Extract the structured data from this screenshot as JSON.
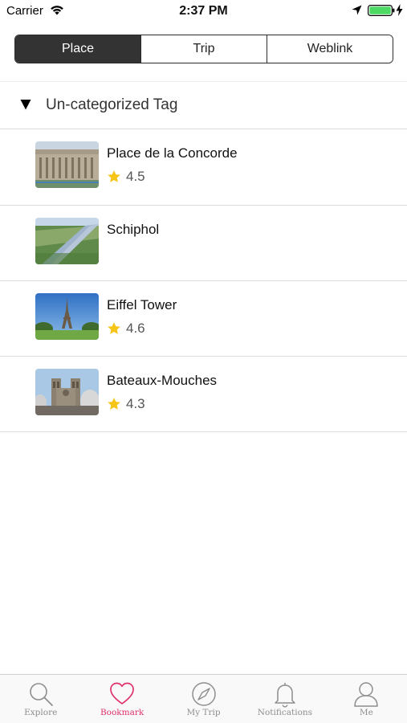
{
  "status_bar": {
    "carrier": "Carrier",
    "time": "2:37 PM",
    "battery_color": "#4cd964"
  },
  "segments": [
    {
      "label": "Place",
      "active": true
    },
    {
      "label": "Trip",
      "active": false
    },
    {
      "label": "Weblink",
      "active": false
    }
  ],
  "section": {
    "title": "Un-categorized Tag",
    "icon": "triangle-down-icon"
  },
  "places": [
    {
      "name": "Place de la Concorde",
      "rating": "4.5",
      "thumb": "building-photo"
    },
    {
      "name": "Schiphol",
      "rating": "",
      "thumb": "river-aerial-photo"
    },
    {
      "name": "Eiffel Tower",
      "rating": "4.6",
      "thumb": "eiffel-tower-photo"
    },
    {
      "name": "Bateaux-Mouches",
      "rating": "4.3",
      "thumb": "cathedral-photo"
    }
  ],
  "tab_bar": {
    "accent_color": "#e0306e",
    "tabs": [
      {
        "label": "Explore",
        "icon": "search-icon",
        "active": false
      },
      {
        "label": "Bookmark",
        "icon": "heart-icon",
        "active": true
      },
      {
        "label": "My Trip",
        "icon": "compass-icon",
        "active": false
      },
      {
        "label": "Notifications",
        "icon": "bell-icon",
        "active": false
      },
      {
        "label": "Me",
        "icon": "person-icon",
        "active": false
      }
    ]
  }
}
